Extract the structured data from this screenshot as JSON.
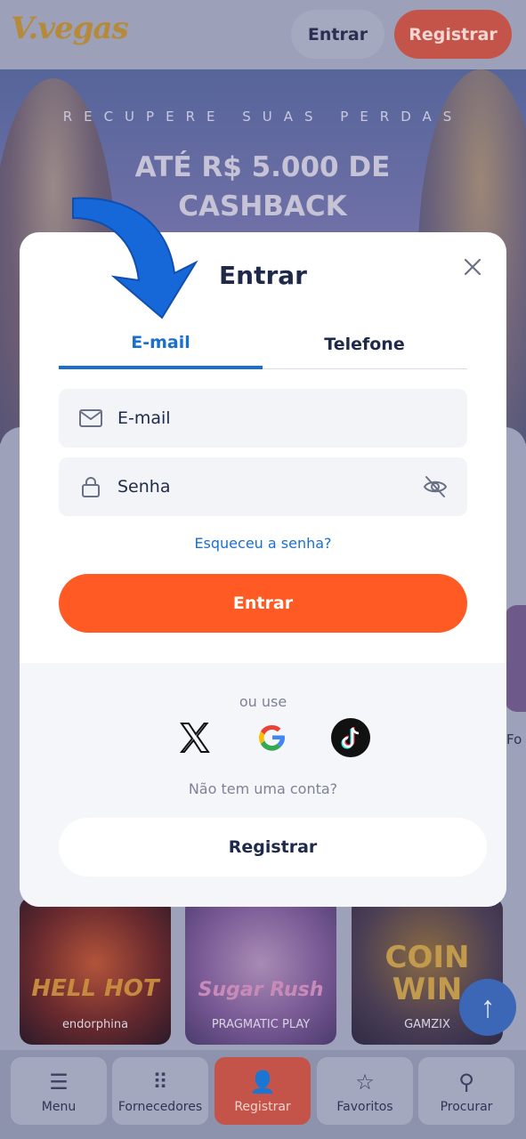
{
  "header": {
    "logo": "V.vegas",
    "login_label": "Entrar",
    "register_label": "Registrar"
  },
  "banner": {
    "kicker": "RECUPERE SUAS PERDAS",
    "headline": "ATÉ R$ 5.000 DE CASHBACK"
  },
  "side_text": "Fo",
  "games": [
    {
      "title": "HELL HOT",
      "provider": "endorphina"
    },
    {
      "title": "Sugar Rush",
      "provider": "PRAGMATIC PLAY"
    },
    {
      "title": "COIN WIN",
      "provider": "GAMZIX"
    }
  ],
  "bottom_nav": {
    "items": [
      {
        "label": "Menu",
        "icon": "menu-icon"
      },
      {
        "label": "Fornecedores",
        "icon": "grid-icon"
      },
      {
        "label": "Registrar",
        "icon": "add-user-icon"
      },
      {
        "label": "Favoritos",
        "icon": "star-icon"
      },
      {
        "label": "Procurar",
        "icon": "search-icon"
      }
    ]
  },
  "modal": {
    "title": "Entrar",
    "tabs": [
      {
        "label": "E-mail",
        "active": true
      },
      {
        "label": "Telefone",
        "active": false
      }
    ],
    "email_placeholder": "E-mail",
    "password_placeholder": "Senha",
    "forgot_label": "Esqueceu a senha?",
    "submit_label": "Entrar",
    "or_use_label": "ou use",
    "social": [
      "x-icon",
      "google-icon",
      "tiktok-icon"
    ],
    "no_account_label": "Não tem uma conta?",
    "register_label": "Registrar"
  },
  "colors": {
    "accent_blue": "#1a6fd1",
    "primary_orange": "#ff5a23",
    "register_red": "#c4544a"
  }
}
